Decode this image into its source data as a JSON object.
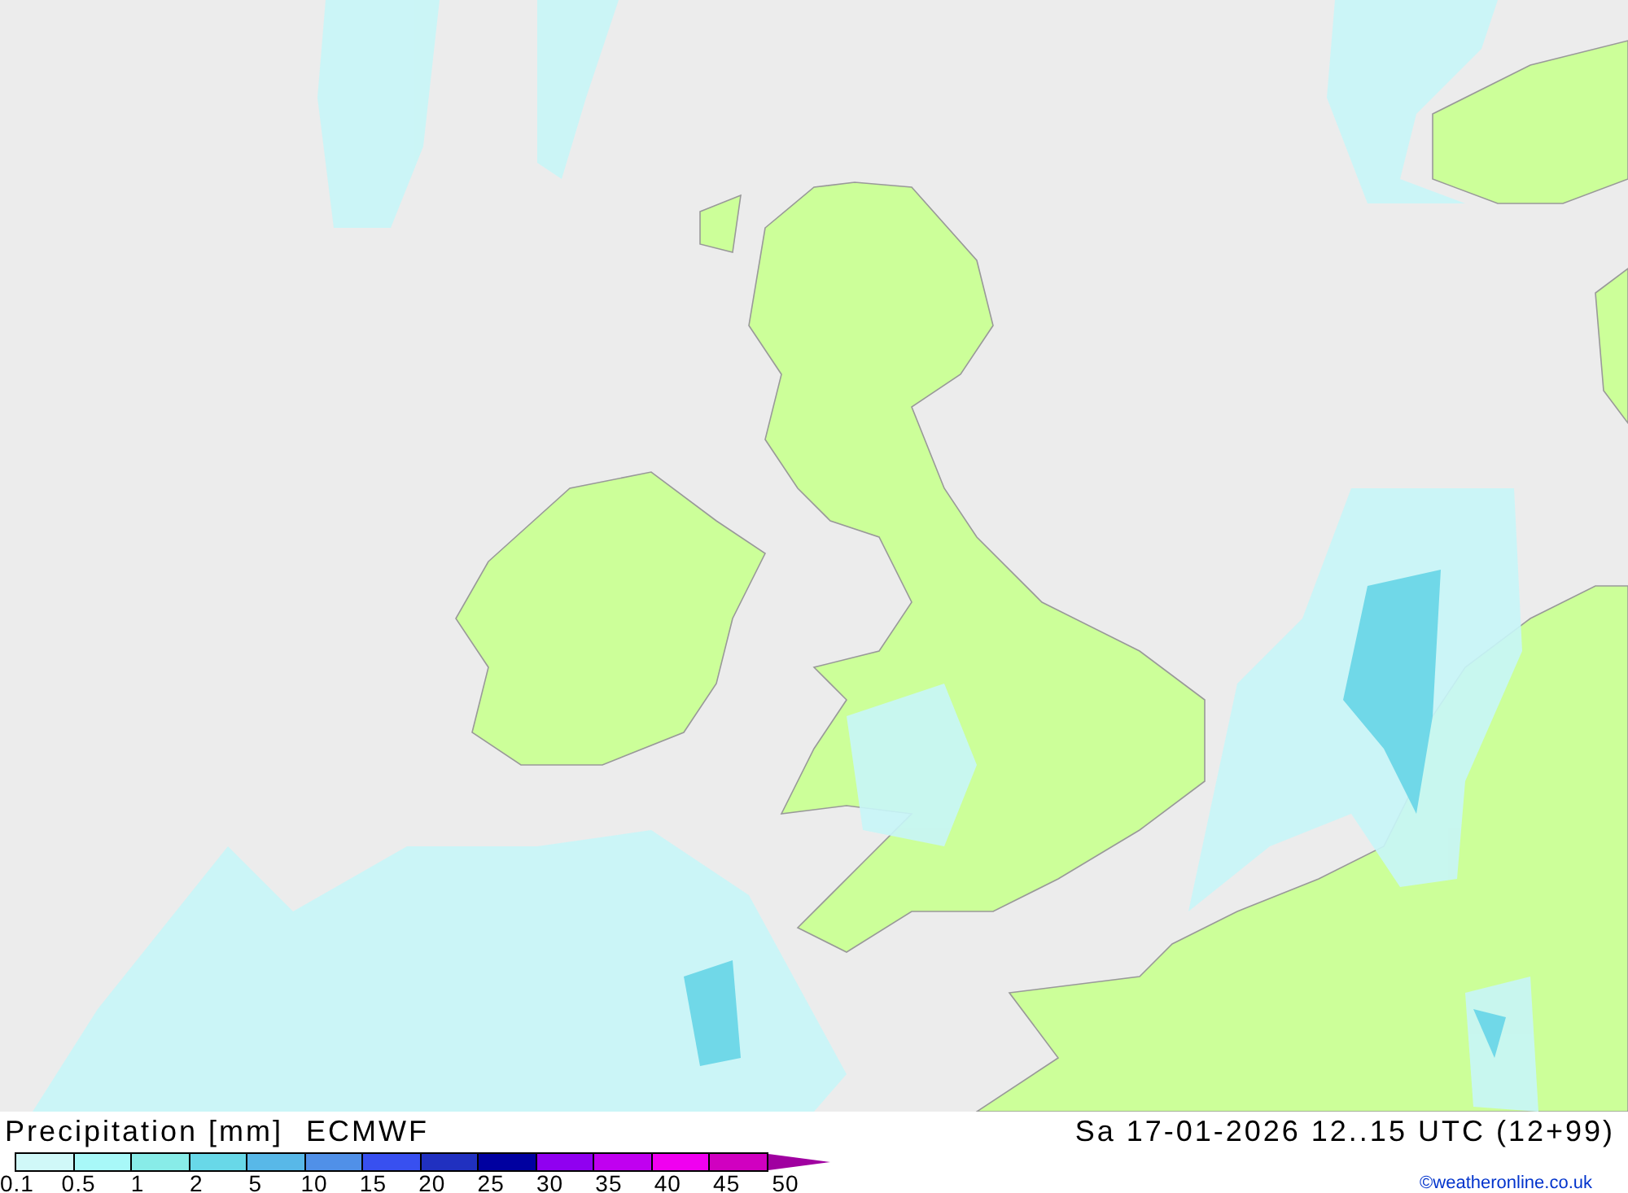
{
  "legend": {
    "title": "Precipitation [mm]",
    "model": "ECMWF",
    "swatches": [
      {
        "color": "#d0f8f8"
      },
      {
        "color": "#a8f8f8"
      },
      {
        "color": "#88ece8"
      },
      {
        "color": "#68d8e8"
      },
      {
        "color": "#58b8e8"
      },
      {
        "color": "#5090e8"
      },
      {
        "color": "#3850f0"
      },
      {
        "color": "#2030c0"
      },
      {
        "color": "#0000a0"
      },
      {
        "color": "#9000f0"
      },
      {
        "color": "#c000f0"
      },
      {
        "color": "#f000f0"
      },
      {
        "color": "#d000c0"
      }
    ],
    "ticks": [
      "0.1",
      "0.5",
      "1",
      "2",
      "5",
      "10",
      "15",
      "20",
      "25",
      "30",
      "35",
      "40",
      "45",
      "50"
    ]
  },
  "valid_time": "Sa 17-01-2026 12..15 UTC (12+99)",
  "credit": "©weatheronline.co.uk"
}
